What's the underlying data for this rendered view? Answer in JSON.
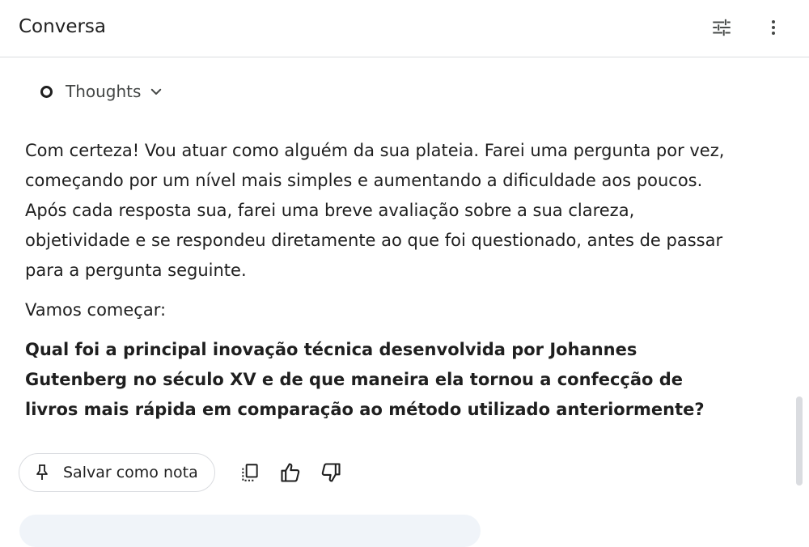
{
  "header": {
    "title": "Conversa",
    "tune_icon": "tune-icon",
    "more_icon": "more-vert-icon"
  },
  "thoughts": {
    "label": "Thoughts",
    "icon": "chevron-down-icon"
  },
  "response": {
    "intro": "Com certeza! Vou atuar como alguém da sua plateia. Farei uma pergunta por vez, começando por um nível mais simples e aumentando a dificuldade aos poucos. Após cada resposta sua, farei uma breve avaliação sobre a sua clareza, objetividade e se respondeu diretamente ao que foi questionado, antes de passar para a pergunta seguinte.",
    "start": "Vamos começar:",
    "question": "Qual foi a principal inovação técnica desenvolvida por Johannes Gutenberg no século XV e de que maneira ela tornou a confecção de livros mais rápida em comparação ao método utilizado anteriormente?"
  },
  "actions": {
    "save_note_label": "Salvar como nota",
    "icons": [
      "pin-icon",
      "copy-icon",
      "thumb-up-icon",
      "thumb-down-icon"
    ]
  }
}
